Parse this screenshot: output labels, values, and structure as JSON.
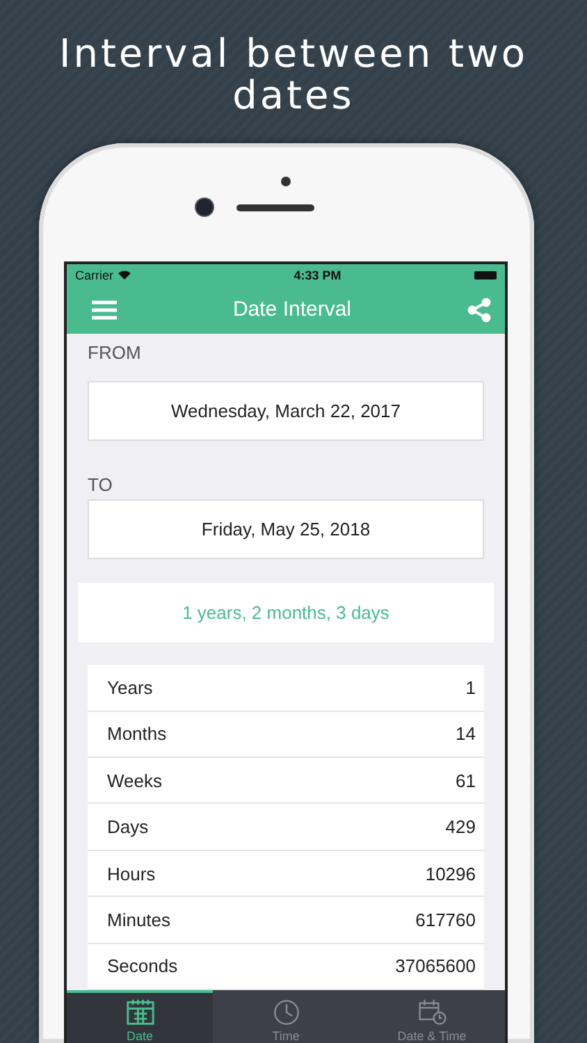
{
  "headline": "Interval between two dates",
  "status_bar": {
    "carrier": "Carrier",
    "time": "4:33 PM"
  },
  "nav": {
    "title": "Date Interval"
  },
  "from": {
    "label": "FROM",
    "value": "Wednesday, March 22, 2017"
  },
  "to": {
    "label": "TO",
    "value": "Friday, May 25, 2018"
  },
  "summary": "1 years, 2 months, 3 days",
  "rows": [
    {
      "label": "Years",
      "value": "1"
    },
    {
      "label": "Months",
      "value": "14"
    },
    {
      "label": "Weeks",
      "value": "61"
    },
    {
      "label": "Days",
      "value": "429"
    },
    {
      "label": "Hours",
      "value": "10296"
    },
    {
      "label": "Minutes",
      "value": "617760"
    },
    {
      "label": "Seconds",
      "value": "37065600"
    }
  ],
  "tabs": [
    {
      "kind": "date",
      "label": "Date",
      "selected": true
    },
    {
      "kind": "time",
      "label": "Time",
      "selected": false
    },
    {
      "kind": "datetime",
      "label": "Date & Time",
      "selected": false
    }
  ]
}
